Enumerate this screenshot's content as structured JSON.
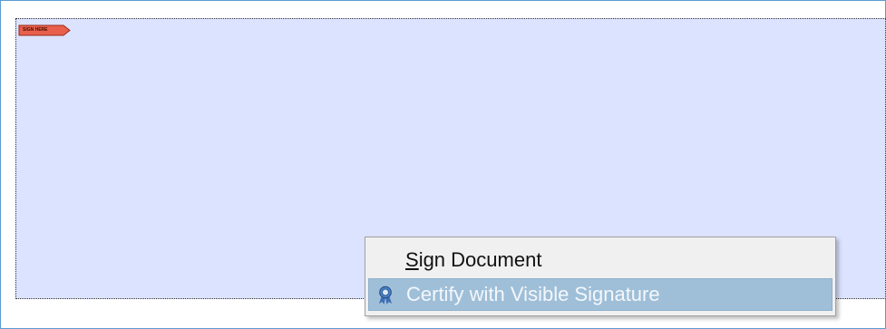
{
  "signature_field": {
    "tag_label": "SIGN HERE",
    "tag_color": "#e8604c",
    "field_background": "#dce3ff"
  },
  "context_menu": {
    "items": [
      {
        "mnemonic": "S",
        "label_rest": "ign Document",
        "enabled": true,
        "highlighted": false
      },
      {
        "mnemonic": "",
        "label_rest": "Certify with Visible Signature",
        "icon": "certificate-ribbon-icon",
        "enabled": false,
        "highlighted": true
      }
    ],
    "highlight_color": "#9fbfd8"
  }
}
